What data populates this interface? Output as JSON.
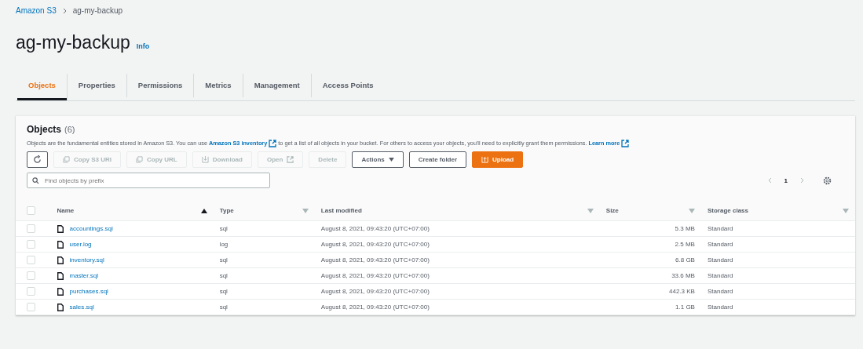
{
  "breadcrumb": [
    {
      "label": "Amazon S3",
      "link": true
    },
    {
      "label": "ag-my-backup",
      "link": false
    }
  ],
  "title": "ag-my-backup",
  "info": "Info",
  "tabs": [
    {
      "label": "Objects",
      "selected": true
    },
    {
      "label": "Properties",
      "selected": false
    },
    {
      "label": "Permissions",
      "selected": false
    },
    {
      "label": "Metrics",
      "selected": false
    },
    {
      "label": "Management",
      "selected": false
    },
    {
      "label": "Access Points",
      "selected": false
    }
  ],
  "panel": {
    "title": "Objects",
    "count": "(6)",
    "description": [
      {
        "kind": "text",
        "text": "Objects are the fundamental entities stored in Amazon S3. You can use "
      },
      {
        "kind": "link",
        "text": "Amazon S3 inventory",
        "external": true
      },
      {
        "kind": "text",
        "text": " to get a list of all objects in your bucket. For others to access your objects, you'll need to explicitly grant them permissions. "
      },
      {
        "kind": "link",
        "text": "Learn more",
        "external": true
      }
    ],
    "buttons": [
      {
        "kind": "refresh",
        "disabled": false
      },
      {
        "kind": "copy",
        "label": "Copy S3 URI",
        "disabled": true
      },
      {
        "kind": "copy",
        "label": "Copy URL",
        "disabled": true
      },
      {
        "kind": "download",
        "label": "Download",
        "disabled": true
      },
      {
        "kind": "open",
        "label": "Open",
        "disabled": true
      },
      {
        "kind": "plain",
        "label": "Delete",
        "disabled": true
      },
      {
        "kind": "dropdown",
        "label": "Actions",
        "disabled": false
      },
      {
        "kind": "plain",
        "label": "Create folder",
        "disabled": false
      },
      {
        "kind": "primary",
        "label": "Upload",
        "disabled": false
      }
    ],
    "search": {
      "placeholder": "Find objects by prefix"
    },
    "page": "1"
  },
  "table": {
    "all_checked": false,
    "columns": [
      {
        "label": "Name",
        "sorted": true
      },
      {
        "label": "Type",
        "sorted": false
      },
      {
        "label": "Last modified",
        "sorted": false
      },
      {
        "label": "Size",
        "sorted": false
      },
      {
        "label": "Storage class",
        "sorted": false
      }
    ],
    "rows": [
      {
        "checked": false,
        "name": "accountings.sql",
        "type": "sql",
        "modified": "August 8, 2021, 09:43:20 (UTC+07:00)",
        "size": "5.3 MB",
        "storage": "Standard"
      },
      {
        "checked": false,
        "name": "user.log",
        "type": "log",
        "modified": "August 8, 2021, 09:43:20 (UTC+07:00)",
        "size": "2.5 MB",
        "storage": "Standard"
      },
      {
        "checked": false,
        "name": "inventory.sql",
        "type": "sql",
        "modified": "August 8, 2021, 09:43:20 (UTC+07:00)",
        "size": "6.8 GB",
        "storage": "Standard"
      },
      {
        "checked": false,
        "name": "master.sql",
        "type": "sql",
        "modified": "August 8, 2021, 09:43:20 (UTC+07:00)",
        "size": "33.6 MB",
        "storage": "Standard"
      },
      {
        "checked": false,
        "name": "purchases.sql",
        "type": "sql",
        "modified": "August 8, 2021, 09:43:20 (UTC+07:00)",
        "size": "442.3 KB",
        "storage": "Standard"
      },
      {
        "checked": false,
        "name": "sales.sql",
        "type": "sql",
        "modified": "August 8, 2021, 09:43:20 (UTC+07:00)",
        "size": "1.1 GB",
        "storage": "Standard"
      }
    ]
  }
}
